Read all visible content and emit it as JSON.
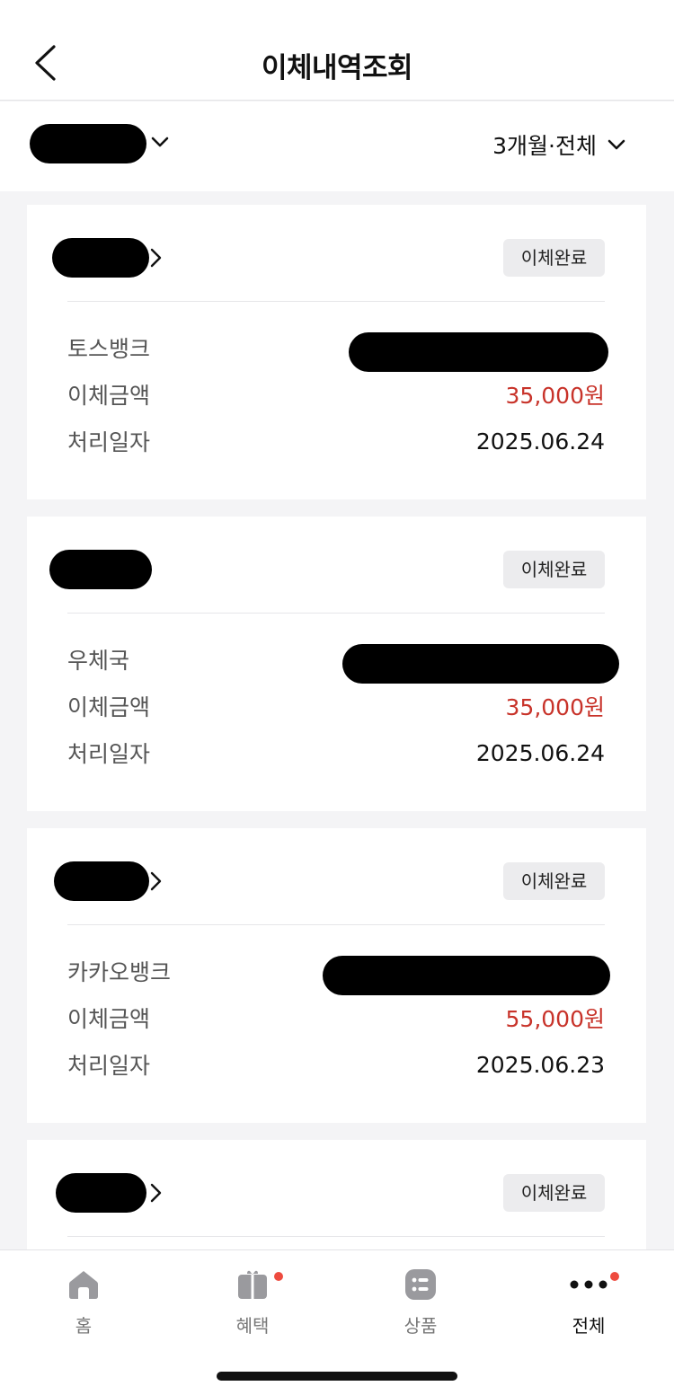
{
  "header": {
    "title": "이체내역조회",
    "back_icon": "chevron-left-icon"
  },
  "filter": {
    "account_redacted": true,
    "period_label": "3개월·전체"
  },
  "labels": {
    "amount": "이체금액",
    "date": "처리일자"
  },
  "transfers": [
    {
      "recipient_redacted": true,
      "status": "이체완료",
      "bank": "토스뱅크",
      "amount": "35,000원",
      "date": "2025.06.24"
    },
    {
      "recipient_redacted": true,
      "status": "이체완료",
      "bank": "우체국",
      "amount": "35,000원",
      "date": "2025.06.24"
    },
    {
      "recipient_redacted": true,
      "status": "이체완료",
      "bank": "카카오뱅크",
      "amount": "55,000원",
      "date": "2025.06.23"
    },
    {
      "recipient_redacted": true,
      "status": "이체완료"
    }
  ],
  "tabbar": {
    "items": [
      {
        "label": "홈",
        "icon": "home-icon",
        "badge": false,
        "active": false
      },
      {
        "label": "혜택",
        "icon": "gift-icon",
        "badge": true,
        "active": false
      },
      {
        "label": "상품",
        "icon": "list-icon",
        "badge": false,
        "active": false
      },
      {
        "label": "전체",
        "icon": "more-dots-icon",
        "badge": true,
        "active": true
      }
    ]
  },
  "colors": {
    "amount": "#c8332a",
    "badge": "#ee4b3f",
    "background": "#f4f4f6"
  }
}
